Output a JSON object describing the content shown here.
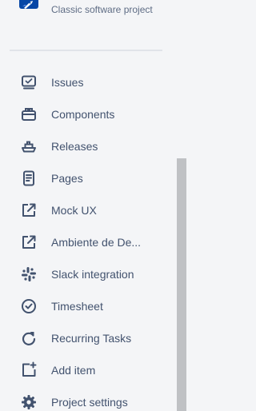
{
  "project": {
    "subtitle": "Classic software project",
    "avatar_icon": "rocket-icon"
  },
  "sidebar": {
    "collapse_icon": "chevron-left-icon",
    "items": [
      {
        "label": "Issues",
        "icon": "issues-icon"
      },
      {
        "label": "Components",
        "icon": "components-icon"
      },
      {
        "label": "Releases",
        "icon": "ship-icon"
      },
      {
        "label": "Pages",
        "icon": "page-icon"
      },
      {
        "label": "Mock UX",
        "icon": "external-link-icon"
      },
      {
        "label": "Ambiente de De...",
        "icon": "external-link-icon"
      },
      {
        "label": "Slack integration",
        "icon": "slack-icon"
      },
      {
        "label": "Timesheet",
        "icon": "check-circle-icon"
      },
      {
        "label": "Recurring Tasks",
        "icon": "refresh-icon"
      },
      {
        "label": "Add item",
        "icon": "add-item-icon"
      },
      {
        "label": "Project settings",
        "icon": "gear-icon"
      }
    ]
  },
  "scrollbar": {
    "visible_fraction": 0.61,
    "position_fraction": 1.0
  },
  "colors": {
    "text": "#42526e",
    "subtitle": "#5e6c84",
    "background": "#f4f5f7",
    "avatar": "#0747a6",
    "scroll_thumb": "#bfc1c4"
  }
}
